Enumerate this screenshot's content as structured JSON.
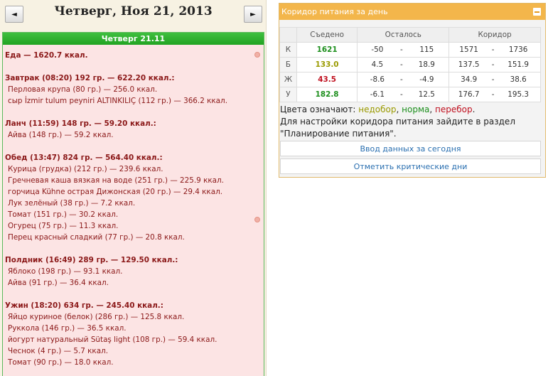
{
  "nav": {
    "date_title": "Четверг, Ноя 21, 2013",
    "prev_symbol": "◄",
    "next_symbol": "►"
  },
  "day": {
    "header": "Четверг 21.11",
    "total": "Еда — 1620.7 ккал.",
    "meals": [
      {
        "title": "Завтрак (08:20) 192 гр. — 622.20 ккал.:",
        "items": [
          "Перловая крупа (80 гр.) — 256.0 ккал.",
          "сыр İzmir tulum peyniri ALTINKILIÇ (112 гр.) — 366.2 ккал."
        ]
      },
      {
        "title": "Ланч (11:59) 148 гр. — 59.20 ккал.:",
        "items": [
          "Айва (148 гр.) — 59.2 ккал."
        ]
      },
      {
        "title": "Обед (13:47) 824 гр. — 564.40 ккал.:",
        "items": [
          "Курица (грудка) (212 гр.) — 239.6 ккал.",
          "Гречневая каша вязкая на воде (251 гр.) — 225.9 ккал.",
          "горчица Kühne острая Дижонская (20 гр.) — 29.4 ккал.",
          "Лук зелёный (38 гр.) — 7.2 ккал.",
          "Томат (151 гр.) — 30.2 ккал.",
          "Огурец (75 гр.) — 11.3 ккал.",
          "Перец красный сладкий (77 гр.) — 20.8 ккал."
        ]
      },
      {
        "title": "Полдник (16:49) 289 гр. — 129.50 ккал.:",
        "items": [
          "Яблоко (198 гр.) — 93.1 ккал.",
          "Айва (91 гр.) — 36.4 ккал."
        ]
      },
      {
        "title": "Ужин (18:20) 634 гр. — 245.40 ккал.:",
        "items": [
          "Яйцо куриное (белок) (286 гр.) — 125.8 ккал.",
          "Руккола (146 гр.) — 36.5 ккал.",
          "йогурт натуральный Sütaş light (108 гр.) — 59.4 ккал.",
          "Чеснок (4 гр.) — 5.7 ккал.",
          "Томат (90 гр.) — 18.0 ккал."
        ]
      }
    ]
  },
  "corridor": {
    "title": "Коридор питания за день",
    "columns": {
      "eaten": "Съедено",
      "left": "Осталось",
      "corridor": "Коридор"
    },
    "rows": [
      {
        "label": "К",
        "eaten": "1621",
        "eaten_color": "#1d8f1d",
        "left_from": "-50",
        "left_to": "115",
        "corr_from": "1571",
        "corr_to": "1736"
      },
      {
        "label": "Б",
        "eaten": "133.0",
        "eaten_color": "#9a9a00",
        "left_from": "4.5",
        "left_to": "18.9",
        "corr_from": "137.5",
        "corr_to": "151.9"
      },
      {
        "label": "Ж",
        "eaten": "43.5",
        "eaten_color": "#c0101f",
        "left_from": "-8.6",
        "left_to": "-4.9",
        "corr_from": "34.9",
        "corr_to": "38.6"
      },
      {
        "label": "У",
        "eaten": "182.8",
        "eaten_color": "#1d8f1d",
        "left_from": "-6.1",
        "left_to": "12.5",
        "corr_from": "176.7",
        "corr_to": "195.3"
      }
    ],
    "legend_prefix": "Цвета означают:",
    "legend_under": "недобор",
    "legend_norm": "норма",
    "legend_over": "перебор",
    "hint_line1": "Для настройки коридора питания зайдите в раздел",
    "hint_line2": "\"Планирование питания\".",
    "btn_enter": "Ввод данных за сегодня",
    "btn_critical": "Отметить критические дни",
    "colors": {
      "under": "#9a9a00",
      "norm": "#1d8f1d",
      "over": "#c0101f",
      "header": "#f3b64b"
    }
  }
}
